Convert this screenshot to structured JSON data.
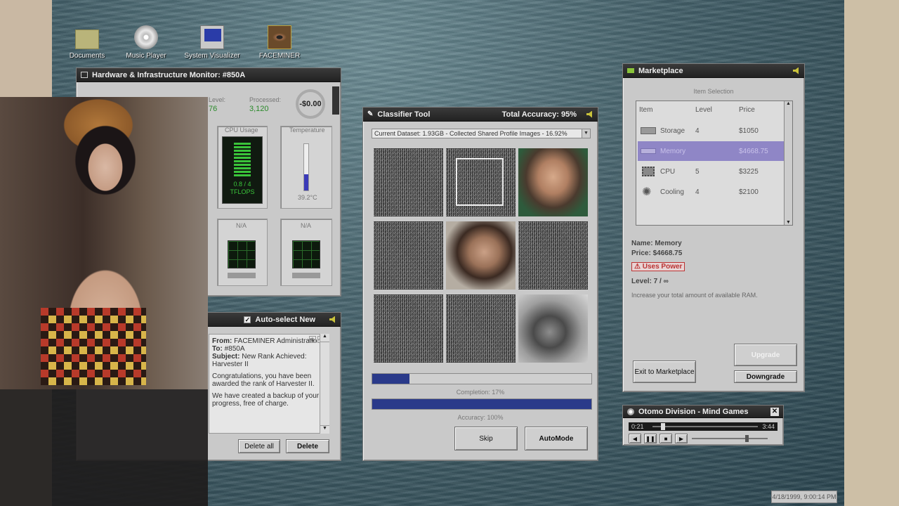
{
  "desktop": {
    "icons": [
      {
        "label": "Documents",
        "icon": "folder-icon"
      },
      {
        "label": "Music Player",
        "icon": "music-cd-icon"
      },
      {
        "label": "System Visualizer",
        "icon": "computer-icon"
      },
      {
        "label": "FACEMINER",
        "icon": "eye-app-icon"
      }
    ]
  },
  "hw_monitor": {
    "title": "Hardware & Infrastructure Monitor: #850A",
    "level_label": "Level:",
    "level_value": "76",
    "processed_label": "Processed:",
    "processed_value": "3,120",
    "money": "-$0.00",
    "cpu_label": "CPU Usage",
    "cpu_value": "0.8 / 4",
    "cpu_unit": "TFLOPS",
    "temp_label": "Temperature",
    "temp_value": "39.2°C",
    "temp_level": 0.35,
    "na1": "N/A",
    "na2": "N/A"
  },
  "mail": {
    "title": "Auto-select New",
    "from_label": "From:",
    "from_value": "FACEMINER Administration",
    "to_label": "To:",
    "to_value": "#850A",
    "subject_label": "Subject:",
    "subject_value": "New Rank Achieved: Harvester II",
    "body1": "Congratulations, you have been awarded the rank of Harvester II.",
    "body2": "We have created a backup of your progress, free of charge.",
    "delete_all": "Delete all",
    "delete": "Delete"
  },
  "classifier": {
    "title": "Classifier Tool",
    "accuracy_title": "Total Accuracy: 95%",
    "dataset": "Current Dataset: 1.93GB - Collected Shared Profile Images - 16.92%",
    "completion_label": "Completion: 17%",
    "completion": 0.17,
    "accuracy_label": "Accuracy: 100%",
    "accuracy": 1.0,
    "skip": "Skip",
    "automode": "AutoMode",
    "tiles": [
      "noise",
      "noise-selected",
      "face",
      "noise",
      "face",
      "noise",
      "noise",
      "noise",
      "face"
    ]
  },
  "marketplace": {
    "title": "Marketplace",
    "section": "Item Selection",
    "headers": {
      "item": "Item",
      "level": "Level",
      "price": "Price"
    },
    "items": [
      {
        "name": "Storage",
        "level": "4",
        "price": "$1050",
        "icon": "storage-icon"
      },
      {
        "name": "Memory",
        "level": "",
        "price": "$4668.75",
        "icon": "memory-icon"
      },
      {
        "name": "CPU",
        "level": "5",
        "price": "$3225",
        "icon": "cpu-chip-icon"
      },
      {
        "name": "Cooling",
        "level": "4",
        "price": "$2100",
        "icon": "cooling-fan-icon"
      }
    ],
    "detail_name": "Name: Memory",
    "detail_price": "Price: $4668.75",
    "uses_power": "Uses Power",
    "detail_level": "Level: 7 / ∞",
    "detail_desc": "Increase your total amount of available RAM.",
    "exit": "Exit to Marketplace",
    "upgrade": "Upgrade",
    "downgrade": "Downgrade"
  },
  "player": {
    "title": "Otomo Division - Mind Games",
    "elapsed": "0:21",
    "total": "3:44",
    "progress": 0.08,
    "volume": 0.7
  },
  "clock": "4/18/1999, 9:00:14 PM"
}
